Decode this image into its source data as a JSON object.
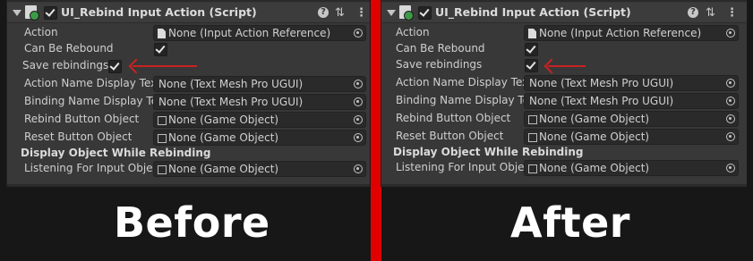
{
  "component": {
    "title": "UI_Rebind Input Action (Script)",
    "header_icons": [
      "help-icon",
      "preset-icon",
      "menu-icon"
    ]
  },
  "panels": {
    "before": {
      "fields": {
        "action": {
          "label": "Action",
          "value": "None (Input Action Reference)"
        },
        "can_be_rebound": {
          "label": "Can Be Rebound",
          "checked": true
        },
        "save_rebindings": {
          "label": "Save rebindings",
          "checked": true
        },
        "action_name_display": {
          "label": "Action Name Display Tex",
          "value": "None (Text Mesh Pro UGUI)"
        },
        "binding_name_display": {
          "label": "Binding Name Display Te",
          "value": "None (Text Mesh Pro UGUI)"
        },
        "rebind_button_object": {
          "label": "Rebind Button Object",
          "value": "None (Game Object)"
        },
        "reset_button_object": {
          "label": "Reset Button Object",
          "value": "None (Game Object)"
        },
        "section_header": "Display Object While Rebinding",
        "listening_for_input": {
          "label": "Listening For Input Objec",
          "value": "None (Game Object)"
        }
      }
    },
    "after": {
      "fields": {
        "action": {
          "label": "Action",
          "value": "None (Input Action Reference)"
        },
        "can_be_rebound": {
          "label": "Can Be Rebound",
          "checked": true
        },
        "save_rebindings": {
          "label": "Save rebindings",
          "checked": true
        },
        "action_name_display": {
          "label": "Action Name Display Tex",
          "value": "None (Text Mesh Pro UGUI)"
        },
        "binding_name_display": {
          "label": "Binding Name Display Te",
          "value": "None (Text Mesh Pro UGUI)"
        },
        "rebind_button_object": {
          "label": "Rebind Button Object",
          "value": "None (Game Object)"
        },
        "reset_button_object": {
          "label": "Reset Button Object",
          "value": "None (Game Object)"
        },
        "section_header": "Display Object While Rebinding",
        "listening_for_input": {
          "label": "Listening For Input Objec",
          "value": "None (Game Object)"
        }
      }
    }
  },
  "captions": {
    "before": "Before",
    "after": "After"
  },
  "colors": {
    "divider": "#e00000",
    "arrow": "#c92222",
    "panel_bg": "#383838",
    "page_bg": "#171717"
  }
}
